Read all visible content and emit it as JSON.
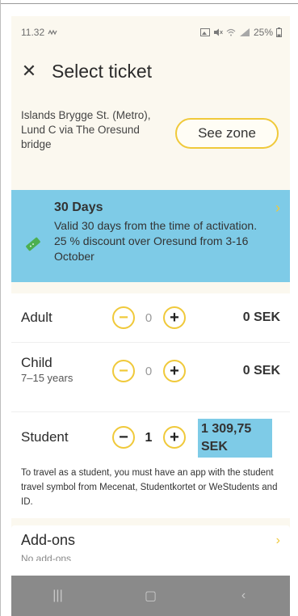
{
  "status": {
    "time": "11.32",
    "battery": "25%"
  },
  "header": {
    "title": "Select ticket",
    "close_icon": "close-icon"
  },
  "route": {
    "text": "Islands Brygge St. (Metro), Lund C via The Oresund bridge",
    "see_zone_label": "See zone"
  },
  "ticket": {
    "title": "30 Days",
    "description": "Valid 30 days from the time of activation. 25 % discount over Oresund from 3-16 October",
    "icon": "ticket-icon",
    "color": "#7ecbe7"
  },
  "passengers": [
    {
      "label": "Adult",
      "sublabel": "",
      "count": "0",
      "price": "0 SEK"
    },
    {
      "label": "Child",
      "sublabel": "7–15 years",
      "count": "0",
      "price": "0 SEK"
    },
    {
      "label": "Student",
      "sublabel": "",
      "count": "1",
      "price": "1 309,75 SEK"
    }
  ],
  "student_note": "To travel as a student, you must have an app with the student travel symbol from Mecenat, Studentkortet or WeStudents and ID.",
  "addons": {
    "title": "Add-ons",
    "subtitle": "No add-ons"
  },
  "colors": {
    "accent_yellow": "#f0c93a",
    "app_background": "#fbf8ef",
    "highlight_blue": "#7ecbe7",
    "navbar": "#8a8a8a"
  },
  "navbar": {
    "recent_icon": "recent-apps-icon",
    "home_icon": "home-icon",
    "back_icon": "back-icon"
  }
}
